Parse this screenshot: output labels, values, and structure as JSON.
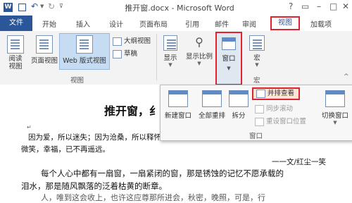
{
  "window": {
    "title": "推开窗.docx - Microsoft Word"
  },
  "ribbon": {
    "tabs": [
      "文件",
      "开始",
      "插入",
      "设计",
      "页面布局",
      "引用",
      "邮件",
      "审阅",
      "视图",
      "加载项"
    ],
    "active_tab": "视图",
    "view_group": {
      "buttons": [
        "阅读视图",
        "页面视图",
        "Web 版式视图"
      ],
      "outline": "大纲视图",
      "draft": "草稿",
      "label": "视图"
    },
    "show_label": "显示",
    "zoom_label": "显示比例",
    "window_button": "窗口",
    "macro_label": "宏",
    "macro_group_label": "宏"
  },
  "window_menu": {
    "new_window": "新建窗口",
    "arrange_all": "全部重排",
    "split": "拆分",
    "side_by_side": "并排查看",
    "sync_scroll": "同步滚动",
    "reset_position": "重设窗口位置",
    "switch_window": "切换窗口",
    "group_label": "窗口"
  },
  "document": {
    "title": "推开窗，纟",
    "line1": "因为爱，所以迷失；因为沧桑，所以释怀。在故事里不拾掇",
    "line2": "微笑，幸福，已不再遥远。",
    "author": "一一文/红尘一笑",
    "para1": "每个人心中都有一扇窗，一扇紧闭的窗，那是锈蚀的记忆不愿承载的",
    "para2": "泪水，那是随风飘落的泛着枯黄的断章。",
    "para3": "人，唯到这会收上，也许这应尊那所进会，秋密，晚照，可是，行"
  }
}
